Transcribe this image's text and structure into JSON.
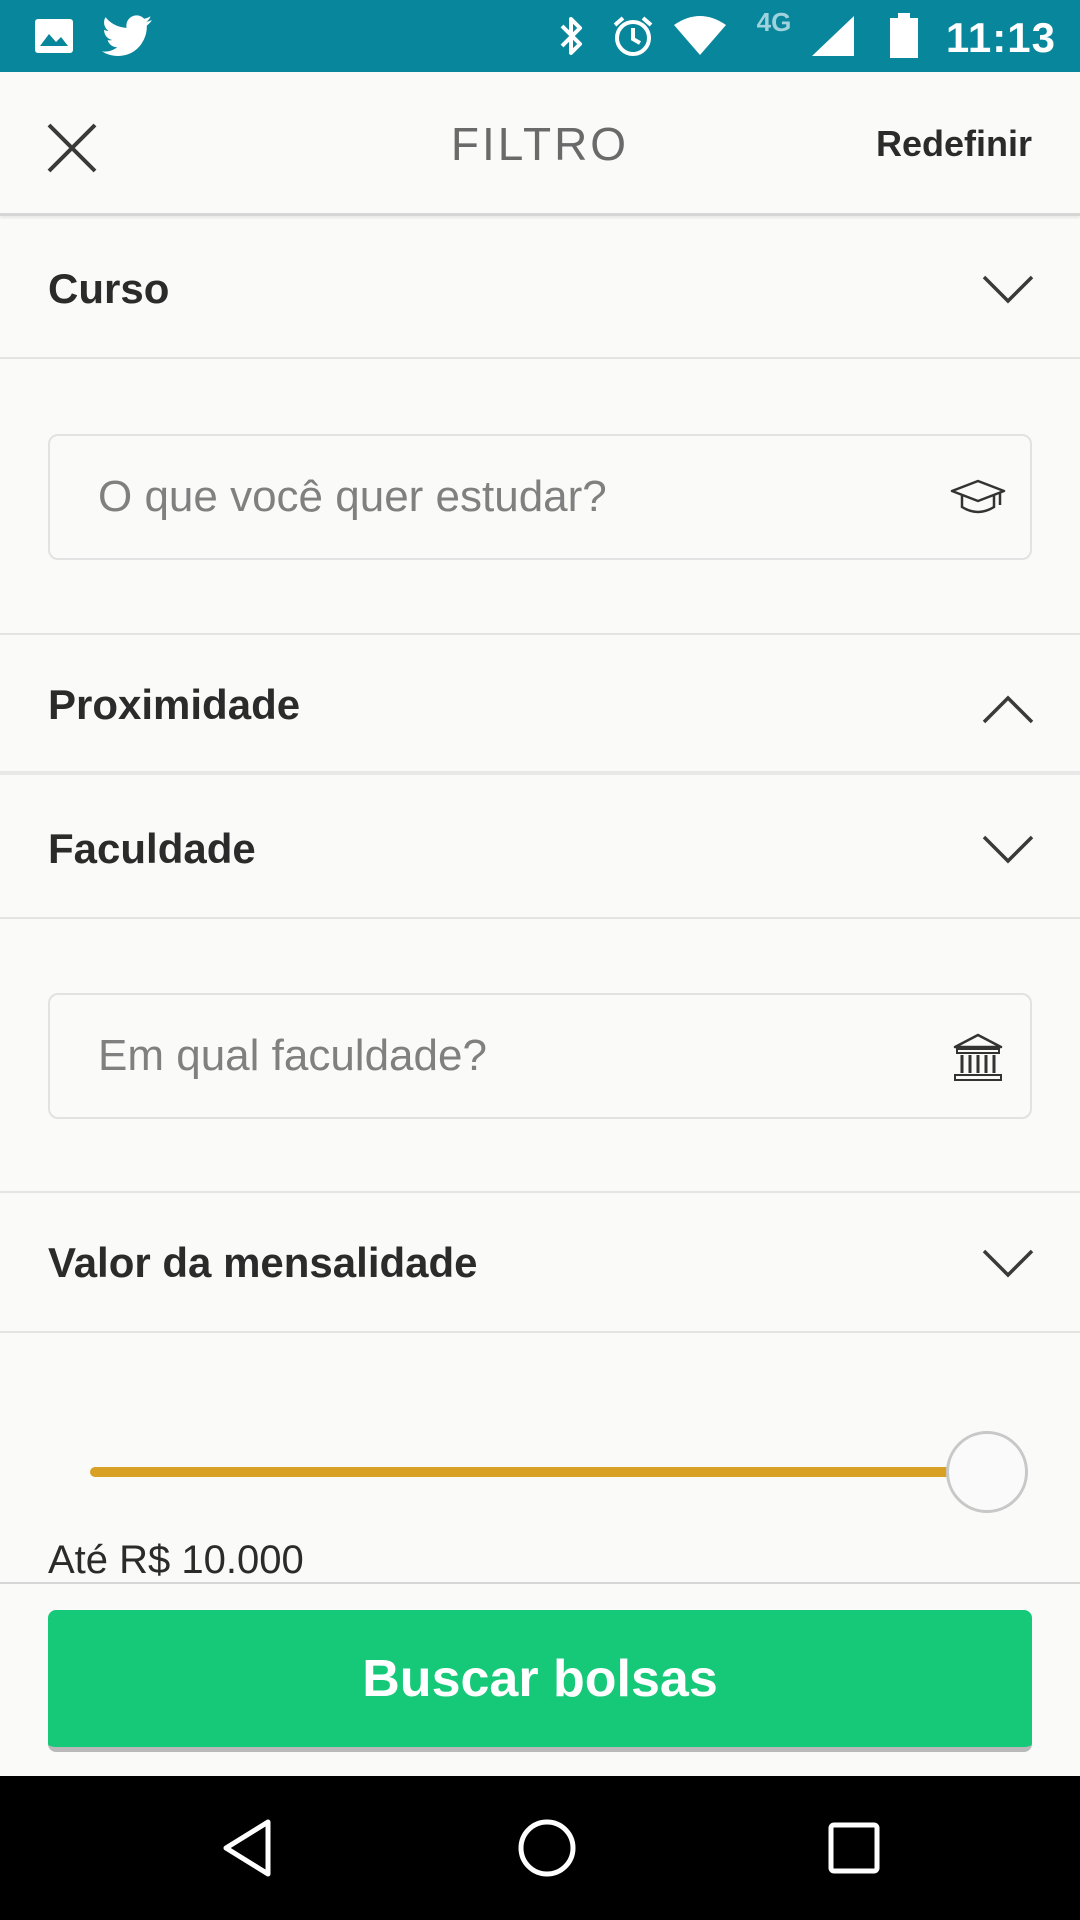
{
  "status_bar": {
    "time": "11:13",
    "network": "4G",
    "background_color": "#08869b",
    "icons": [
      "image-icon",
      "twitter-icon",
      "bluetooth-icon",
      "alarm-icon",
      "wifi-icon",
      "signal-icon",
      "battery-icon"
    ]
  },
  "app_bar": {
    "title": "FILTRO",
    "reset_label": "Redefinir"
  },
  "sections": {
    "curso": {
      "title": "Curso",
      "state": "expanded",
      "placeholder": "O que você quer estudar?",
      "value": ""
    },
    "proximidade": {
      "title": "Proximidade",
      "state": "collapsed"
    },
    "faculdade": {
      "title": "Faculdade",
      "state": "expanded",
      "placeholder": "Em qual faculdade?",
      "value": ""
    },
    "mensalidade": {
      "title": "Valor da mensalidade",
      "state": "expanded",
      "slider_fraction": 1.0,
      "slider_max": 10000,
      "value_label": "Até R$ 10.000"
    }
  },
  "actions": {
    "search_label": "Buscar bolsas"
  },
  "colors": {
    "accent_green": "#15c978",
    "slider_gold": "#d9a026",
    "status_teal": "#08869b"
  },
  "nav": {
    "buttons": [
      "back-icon",
      "home-icon",
      "recents-icon"
    ]
  }
}
